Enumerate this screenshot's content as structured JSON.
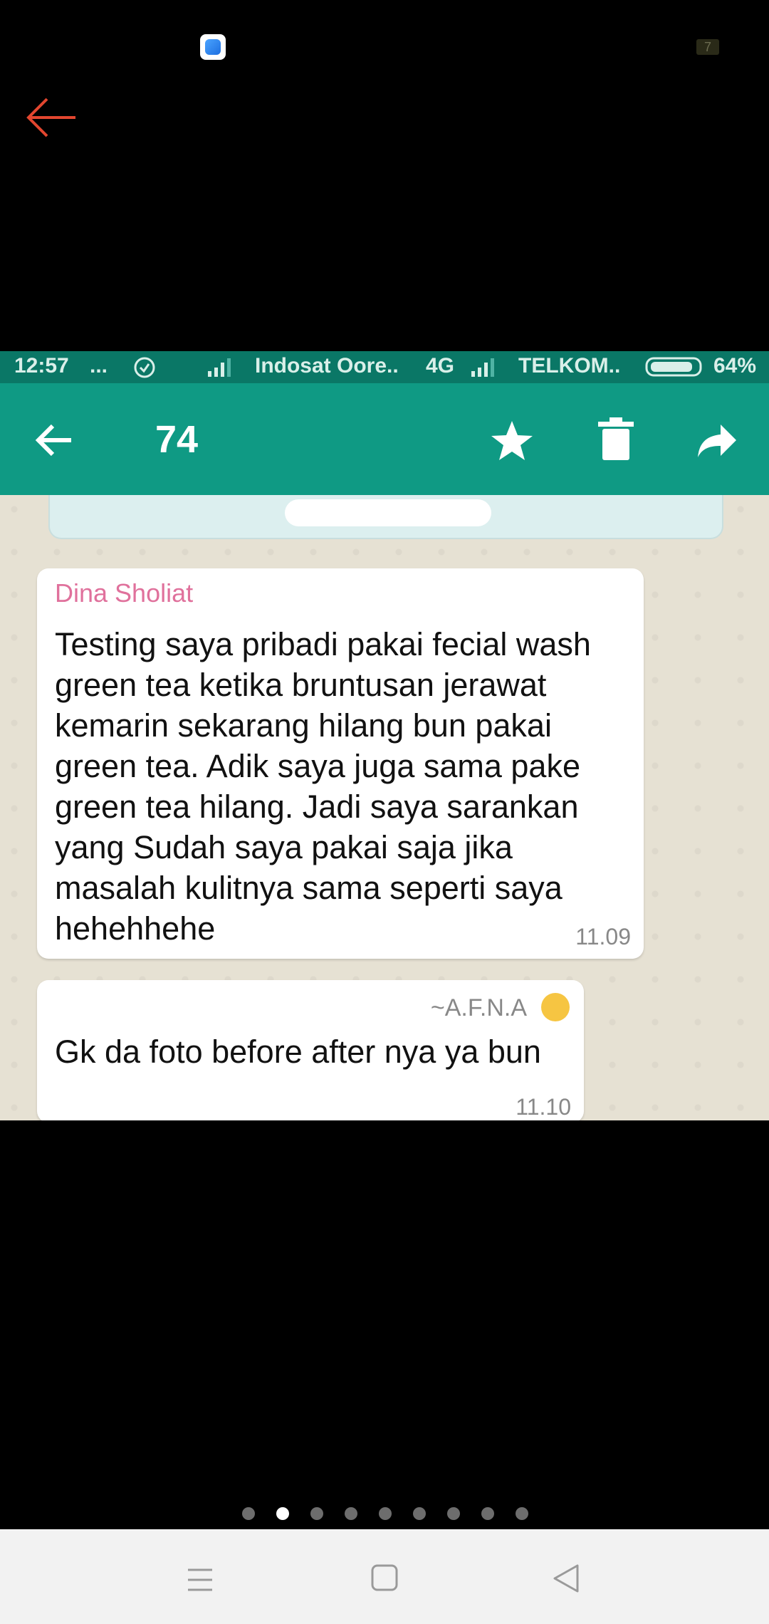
{
  "viewer": {
    "badge_text": "7",
    "icons": [
      "app-icon",
      "back-arrow-icon"
    ],
    "accent_color": "#e2462f"
  },
  "screenshot": {
    "status_bar": {
      "time": "12:57",
      "dots": "...",
      "carrier1": "Indosat Oore..",
      "network": "4G",
      "carrier2": "TELKOM..",
      "battery": "64%"
    },
    "toolbar": {
      "title": "74",
      "color": "#0f9a84",
      "icons": [
        "back-icon",
        "star-icon",
        "delete-icon",
        "forward-icon"
      ]
    },
    "messages": [
      {
        "sender": "Dina Sholiat",
        "text": "Testing saya pribadi pakai fecial wash green tea ketika bruntusan jerawat kemarin sekarang hilang bun pakai green tea. Adik saya juga sama pake green tea hilang. Jadi saya sarankan yang Sudah saya pakai saja jika masalah kulitnya sama seperti saya hehehhehe",
        "time": "11.09"
      },
      {
        "sender": "~A.F.N.A",
        "text": "Gk da foto before after nya ya bun",
        "time": "11.10"
      }
    ]
  },
  "pager": {
    "count": 9,
    "active_index": 1
  },
  "navbar": {
    "icons": [
      "menu-icon",
      "home-icon",
      "back-icon"
    ]
  }
}
